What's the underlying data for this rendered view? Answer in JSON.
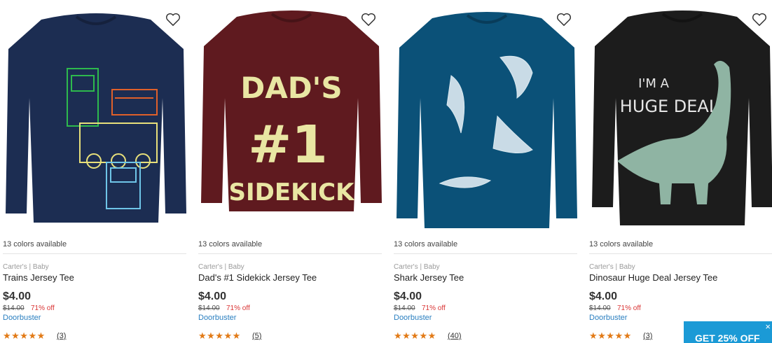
{
  "products": [
    {
      "colors": "13 colors available",
      "brand": "Carter's | Baby",
      "name": "Trains Jersey Tee",
      "price": "$4.00",
      "original_price": "$14.00",
      "discount": "71% off",
      "tag": "Doorbuster",
      "stars": "★★★★★",
      "rating": 5,
      "reviews": "(3)",
      "shirt_color": "#1c2d52",
      "graphic": "trains"
    },
    {
      "colors": "13 colors available",
      "brand": "Carter's | Baby",
      "name": "Dad's #1 Sidekick Jersey Tee",
      "price": "$4.00",
      "original_price": "$14.00",
      "discount": "71% off",
      "tag": "Doorbuster",
      "stars": "★★★★★",
      "rating": 5,
      "reviews": "(5)",
      "shirt_color": "#5f1a1f",
      "graphic": "dad-text",
      "graphic_text": [
        "DAD'S",
        "#1",
        "SIDEKICK"
      ]
    },
    {
      "colors": "13 colors available",
      "brand": "Carter's | Baby",
      "name": "Shark Jersey Tee",
      "price": "$4.00",
      "original_price": "$14.00",
      "discount": "71% off",
      "tag": "Doorbuster",
      "stars": "★★★★★",
      "rating": 5,
      "reviews": "(40)",
      "shirt_color": "#0b5178",
      "graphic": "sharks"
    },
    {
      "colors": "13 colors available",
      "brand": "Carter's | Baby",
      "name": "Dinosaur Huge Deal Jersey Tee",
      "price": "$4.00",
      "original_price": "$14.00",
      "discount": "71% off",
      "tag": "Doorbuster",
      "stars": "★★★★★",
      "rating": 5,
      "reviews": "(3)",
      "shirt_color": "#1c1c1c",
      "graphic": "dinosaur",
      "graphic_text": [
        "I'M A",
        "HUGE DEAL"
      ]
    }
  ],
  "icons": {
    "favorite": "heart-outline-icon",
    "close": "close-icon"
  },
  "promo": {
    "label": "GET 25% OFF",
    "close": "×",
    "color": "#1b9ad6"
  },
  "theme": {
    "price_off_color": "#d93333",
    "tag_color": "#2a7fc0",
    "star_color": "#e27a16"
  }
}
